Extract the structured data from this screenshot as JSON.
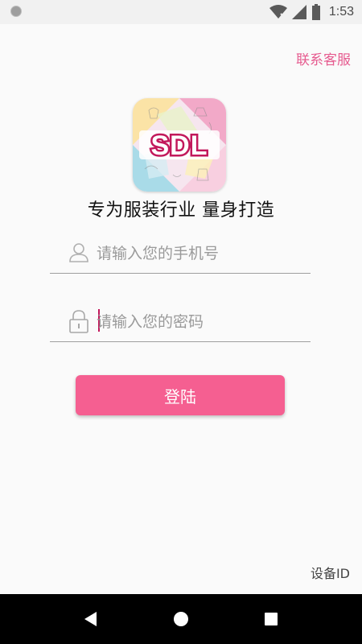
{
  "status_bar": {
    "time": "1:53"
  },
  "header": {
    "contact_label": "联系客服"
  },
  "logo": {
    "text": "SDL"
  },
  "tagline": "专为服装行业 量身打造",
  "form": {
    "phone_placeholder": "请输入您的手机号",
    "password_placeholder": "请输入您的密码",
    "login_label": "登陆"
  },
  "footer": {
    "device_id_label": "设备ID"
  },
  "icons": {
    "phone_field": "user-icon",
    "password_field": "lock-icon",
    "nav_back": "back-icon",
    "nav_home": "home-icon",
    "nav_recents": "recents-icon"
  },
  "colors": {
    "accent": "#f55f91",
    "link": "#e65b8f",
    "logo_red": "#c2185b"
  }
}
